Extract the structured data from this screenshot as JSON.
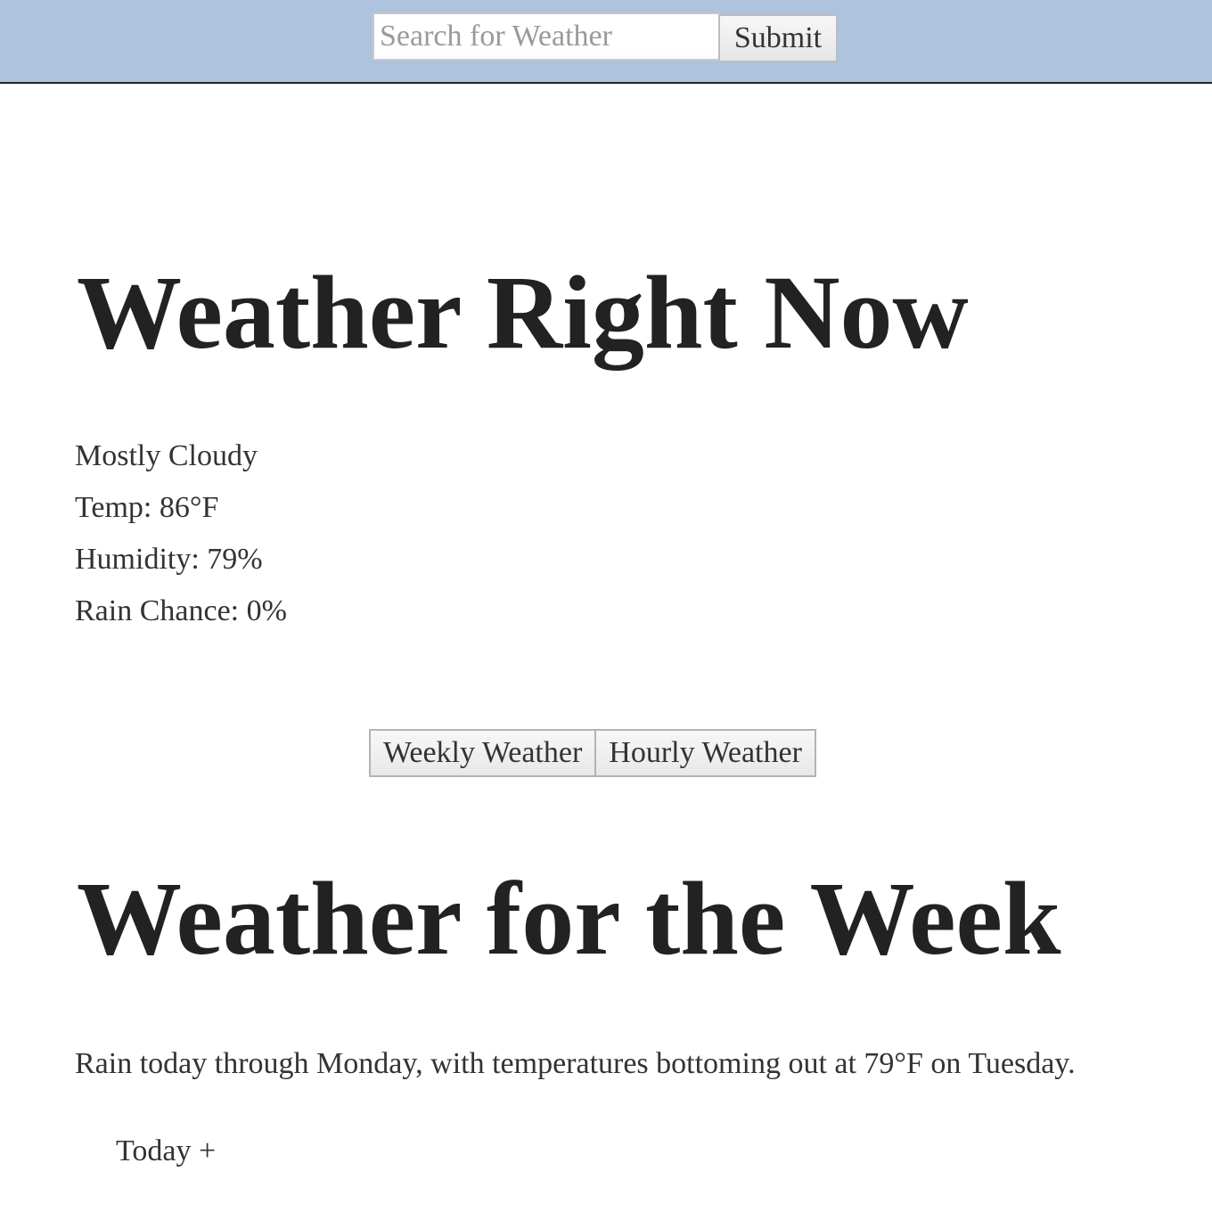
{
  "search": {
    "placeholder": "Search for Weather",
    "value": "",
    "submit_label": "Submit"
  },
  "current": {
    "title": "Weather Right Now",
    "condition": "Mostly Cloudy",
    "temp": "Temp: 86°F",
    "humidity": "Humidity: 79%",
    "rain_chance": "Rain Chance: 0%"
  },
  "view_toggle": {
    "weekly_label": "Weekly Weather",
    "hourly_label": "Hourly Weather"
  },
  "week": {
    "title": "Weather for the Week",
    "summary": "Rain today through Monday, with temperatures bottoming out at 79°F on Tuesday.",
    "days": [
      {
        "label": "Today +"
      }
    ]
  },
  "colors": {
    "header_bg": "#aec3de",
    "text": "#333333",
    "heading": "#222222"
  }
}
